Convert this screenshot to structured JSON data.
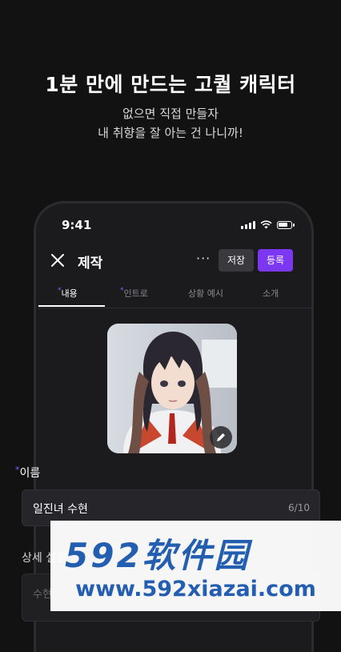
{
  "promo": {
    "title": "1분 만에 만드는 고퀄 캐릭터",
    "subtitle_line1": "없으면 직접 만들자",
    "subtitle_line2": "내 취향을 잘 아는 건 나니까!"
  },
  "status_bar": {
    "time": "9:41"
  },
  "app_bar": {
    "title": "제작",
    "more": "···",
    "save_label": "저장",
    "submit_label": "등록"
  },
  "tabs": [
    {
      "label": "내용",
      "required": "*"
    },
    {
      "label": "인트로",
      "required": "*"
    },
    {
      "label": "상황 예시"
    },
    {
      "label": "소개"
    }
  ],
  "form": {
    "name_label": "이름",
    "name_required": "*",
    "name_value": "일진녀 수현",
    "name_count": "6/10",
    "detail_label": "상세 설정",
    "detail_placeholder": "수현"
  },
  "watermark": {
    "logo": "592软件园",
    "url": "www.592xiazai.com"
  },
  "colors": {
    "accent": "#7b38f0",
    "background": "#121212",
    "watermark": "#2561b8"
  }
}
